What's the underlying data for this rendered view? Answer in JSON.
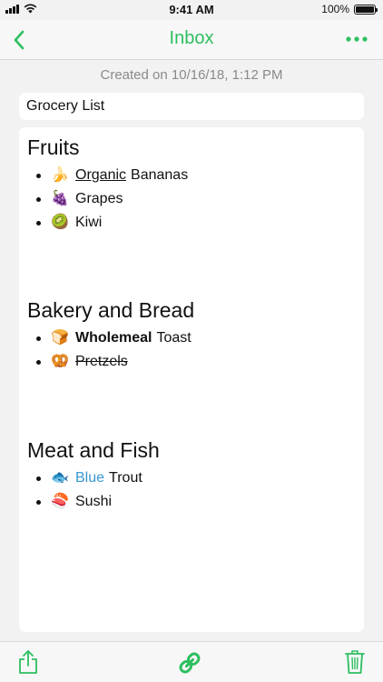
{
  "status_bar": {
    "time": "9:41 AM",
    "battery_percent": "100%",
    "battery_level": 1.0
  },
  "nav": {
    "title": "Inbox",
    "back_icon": "chevron-left-icon",
    "more_icon": "ellipsis-icon"
  },
  "note": {
    "created": "Created on 10/16/18, 1:12 PM",
    "title": "Grocery List",
    "sections": [
      {
        "heading": "Fruits",
        "items": [
          {
            "emoji": "🍌",
            "styled": "Organic",
            "rest": "Bananas"
          },
          {
            "emoji": "🍇",
            "text": "Grapes"
          },
          {
            "emoji": "🥝",
            "text": "Kiwi"
          }
        ]
      },
      {
        "heading": "Bakery and Bread",
        "items": [
          {
            "emoji": "🍞",
            "styled": "Wholemeal",
            "rest": "Toast"
          },
          {
            "emoji": "🥨",
            "text": "Pretzels"
          }
        ]
      },
      {
        "heading": "Meat and Fish",
        "items": [
          {
            "emoji": "🐟",
            "styled": "Blue",
            "rest": "Trout"
          },
          {
            "emoji": "🍣",
            "text": "Sushi"
          }
        ]
      }
    ]
  },
  "toolbar": {
    "share_icon": "share-icon",
    "link_icon": "link-icon",
    "trash_icon": "trash-icon"
  },
  "colors": {
    "accent": "#2dbe60",
    "blue_text": "#3896d3",
    "meta_text": "#8a8a8a"
  }
}
